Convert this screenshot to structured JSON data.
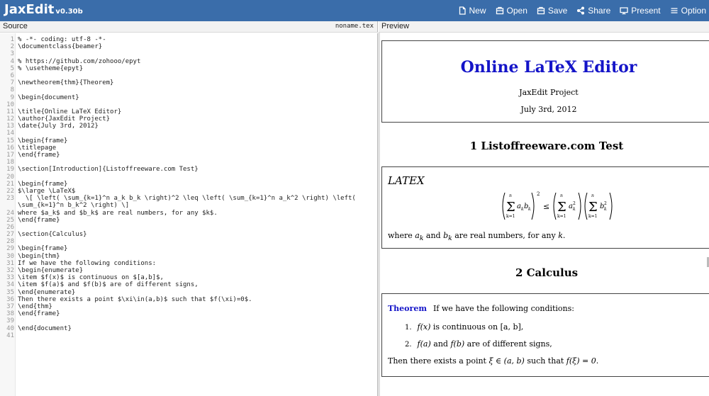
{
  "app": {
    "name": "JaxEdit",
    "version": "v0.30b"
  },
  "menu": {
    "new": "New",
    "open": "Open",
    "save": "Save",
    "share": "Share",
    "present": "Present",
    "option": "Option"
  },
  "source": {
    "label": "Source",
    "filename": "noname.tex"
  },
  "preview_pane": {
    "label": "Preview"
  },
  "code_lines": [
    "% -*- coding: utf-8 -*-",
    "\\documentclass{beamer}",
    "",
    "% https://github.com/zohooo/epyt",
    "% \\usetheme{epyt}",
    "",
    "\\newtheorem{thm}{Theorem}",
    "",
    "\\begin{document}",
    "",
    "\\title{Online LaTeX Editor}",
    "\\author{JaxEdit Project}",
    "\\date{July 3rd, 2012}",
    "",
    "\\begin{frame}",
    "\\titlepage",
    "\\end{frame}",
    "",
    "\\section[Introduction]{Listoffreeware.com Test}",
    "",
    "\\begin{frame}",
    "$\\large \\LaTeX$",
    "  \\[ \\left( \\sum_{k=1}^n a_k b_k \\right)^2 \\leq \\left( \\sum_{k=1}^n a_k^2 \\right) \\left(",
    "\\sum_{k=1}^n b_k^2 \\right) \\]",
    "where $a_k$ and $b_k$ are real numbers, for any $k$.",
    "\\end{frame}",
    "",
    "\\section{Calculus}",
    "",
    "\\begin{frame}",
    "\\begin{thm}",
    "If we have the following conditions:",
    "\\begin{enumerate}",
    "\\item $f(x)$ is continuous on $[a,b]$,",
    "\\item $f(a)$ and $f(b)$ are of different signs,",
    "\\end{enumerate}",
    "Then there exists a point $\\xi\\in(a,b)$ such that $f(\\xi)=0$.",
    "\\end{thm}",
    "\\end{frame}",
    "",
    "\\end{document}",
    ""
  ],
  "line_numbers": [
    "1",
    "2",
    "3",
    "4",
    "5",
    "6",
    "7",
    "8",
    "9",
    "10",
    "11",
    "12",
    "13",
    "14",
    "15",
    "16",
    "17",
    "18",
    "19",
    "20",
    "21",
    "22",
    "23",
    "",
    "24",
    "25",
    "26",
    "27",
    "28",
    "29",
    "30",
    "31",
    "32",
    "33",
    "34",
    "35",
    "36",
    "37",
    "38",
    "39",
    "40",
    "41"
  ],
  "doc": {
    "title": "Online LaTeX Editor",
    "author": "JaxEdit Project",
    "date": "July 3rd, 2012",
    "section1": "1 Listoffreeware.com Test",
    "latex_logo": "LATEX",
    "sentence1_pre": "where ",
    "sentence1_a": "a",
    "sentence1_ak_sub": "k",
    "sentence1_mid": " and ",
    "sentence1_b": "b",
    "sentence1_post": " are real numbers, for any ",
    "sentence1_k": "k",
    "sentence1_end": ".",
    "section2": "2 Calculus",
    "theorem_label": "Theorem",
    "theorem_intro": "If we have the following conditions:",
    "item1_num": "1.",
    "item1_f": "f",
    "item1_x": "(x)",
    "item1_rest": " is continuous on ",
    "item1_interval": "[a, b]",
    "item1_end": ",",
    "item2_num": "2.",
    "item2_fa": "f(a)",
    "item2_and": " and ",
    "item2_fb": "f(b)",
    "item2_rest": " are of different signs,",
    "conclusion_pre": "Then there exists a point ",
    "conclusion_xi": "ξ ∈ (a, b)",
    "conclusion_mid": " such that ",
    "conclusion_eq": "f(ξ) = 0",
    "conclusion_end": "."
  },
  "formula": {
    "sum_top": "n",
    "sum_bottom": "k=1",
    "term1": "a",
    "term1_sub": "k",
    "term1b": "b",
    "term1b_sub": "k",
    "exp": "2",
    "leq": "≤",
    "term2": "a",
    "term2_sub": "k",
    "term2_sup": "2",
    "term3": "b",
    "term3_sub": "k",
    "term3_sup": "2"
  },
  "colors": {
    "topbar": "#3a6daa",
    "title_blue": "#1414c8",
    "comment": "#a45c1a",
    "arg": "#2d7a18"
  }
}
